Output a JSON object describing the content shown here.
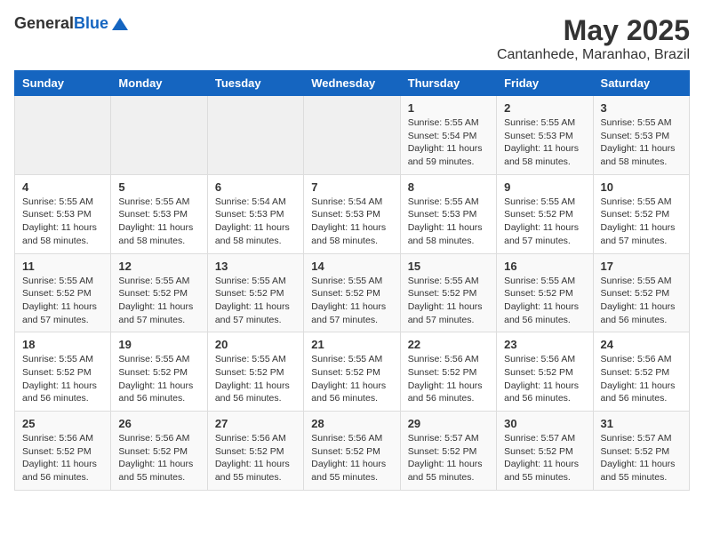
{
  "logo": {
    "general": "General",
    "blue": "Blue"
  },
  "title": "May 2025",
  "subtitle": "Cantanhede, Maranhao, Brazil",
  "days_header": [
    "Sunday",
    "Monday",
    "Tuesday",
    "Wednesday",
    "Thursday",
    "Friday",
    "Saturday"
  ],
  "weeks": [
    [
      {
        "day": "",
        "info": ""
      },
      {
        "day": "",
        "info": ""
      },
      {
        "day": "",
        "info": ""
      },
      {
        "day": "",
        "info": ""
      },
      {
        "day": "1",
        "info": "Sunrise: 5:55 AM\nSunset: 5:54 PM\nDaylight: 11 hours and 59 minutes."
      },
      {
        "day": "2",
        "info": "Sunrise: 5:55 AM\nSunset: 5:53 PM\nDaylight: 11 hours and 58 minutes."
      },
      {
        "day": "3",
        "info": "Sunrise: 5:55 AM\nSunset: 5:53 PM\nDaylight: 11 hours and 58 minutes."
      }
    ],
    [
      {
        "day": "4",
        "info": "Sunrise: 5:55 AM\nSunset: 5:53 PM\nDaylight: 11 hours and 58 minutes."
      },
      {
        "day": "5",
        "info": "Sunrise: 5:55 AM\nSunset: 5:53 PM\nDaylight: 11 hours and 58 minutes."
      },
      {
        "day": "6",
        "info": "Sunrise: 5:54 AM\nSunset: 5:53 PM\nDaylight: 11 hours and 58 minutes."
      },
      {
        "day": "7",
        "info": "Sunrise: 5:54 AM\nSunset: 5:53 PM\nDaylight: 11 hours and 58 minutes."
      },
      {
        "day": "8",
        "info": "Sunrise: 5:55 AM\nSunset: 5:53 PM\nDaylight: 11 hours and 58 minutes."
      },
      {
        "day": "9",
        "info": "Sunrise: 5:55 AM\nSunset: 5:52 PM\nDaylight: 11 hours and 57 minutes."
      },
      {
        "day": "10",
        "info": "Sunrise: 5:55 AM\nSunset: 5:52 PM\nDaylight: 11 hours and 57 minutes."
      }
    ],
    [
      {
        "day": "11",
        "info": "Sunrise: 5:55 AM\nSunset: 5:52 PM\nDaylight: 11 hours and 57 minutes."
      },
      {
        "day": "12",
        "info": "Sunrise: 5:55 AM\nSunset: 5:52 PM\nDaylight: 11 hours and 57 minutes."
      },
      {
        "day": "13",
        "info": "Sunrise: 5:55 AM\nSunset: 5:52 PM\nDaylight: 11 hours and 57 minutes."
      },
      {
        "day": "14",
        "info": "Sunrise: 5:55 AM\nSunset: 5:52 PM\nDaylight: 11 hours and 57 minutes."
      },
      {
        "day": "15",
        "info": "Sunrise: 5:55 AM\nSunset: 5:52 PM\nDaylight: 11 hours and 57 minutes."
      },
      {
        "day": "16",
        "info": "Sunrise: 5:55 AM\nSunset: 5:52 PM\nDaylight: 11 hours and 56 minutes."
      },
      {
        "day": "17",
        "info": "Sunrise: 5:55 AM\nSunset: 5:52 PM\nDaylight: 11 hours and 56 minutes."
      }
    ],
    [
      {
        "day": "18",
        "info": "Sunrise: 5:55 AM\nSunset: 5:52 PM\nDaylight: 11 hours and 56 minutes."
      },
      {
        "day": "19",
        "info": "Sunrise: 5:55 AM\nSunset: 5:52 PM\nDaylight: 11 hours and 56 minutes."
      },
      {
        "day": "20",
        "info": "Sunrise: 5:55 AM\nSunset: 5:52 PM\nDaylight: 11 hours and 56 minutes."
      },
      {
        "day": "21",
        "info": "Sunrise: 5:55 AM\nSunset: 5:52 PM\nDaylight: 11 hours and 56 minutes."
      },
      {
        "day": "22",
        "info": "Sunrise: 5:56 AM\nSunset: 5:52 PM\nDaylight: 11 hours and 56 minutes."
      },
      {
        "day": "23",
        "info": "Sunrise: 5:56 AM\nSunset: 5:52 PM\nDaylight: 11 hours and 56 minutes."
      },
      {
        "day": "24",
        "info": "Sunrise: 5:56 AM\nSunset: 5:52 PM\nDaylight: 11 hours and 56 minutes."
      }
    ],
    [
      {
        "day": "25",
        "info": "Sunrise: 5:56 AM\nSunset: 5:52 PM\nDaylight: 11 hours and 56 minutes."
      },
      {
        "day": "26",
        "info": "Sunrise: 5:56 AM\nSunset: 5:52 PM\nDaylight: 11 hours and 55 minutes."
      },
      {
        "day": "27",
        "info": "Sunrise: 5:56 AM\nSunset: 5:52 PM\nDaylight: 11 hours and 55 minutes."
      },
      {
        "day": "28",
        "info": "Sunrise: 5:56 AM\nSunset: 5:52 PM\nDaylight: 11 hours and 55 minutes."
      },
      {
        "day": "29",
        "info": "Sunrise: 5:57 AM\nSunset: 5:52 PM\nDaylight: 11 hours and 55 minutes."
      },
      {
        "day": "30",
        "info": "Sunrise: 5:57 AM\nSunset: 5:52 PM\nDaylight: 11 hours and 55 minutes."
      },
      {
        "day": "31",
        "info": "Sunrise: 5:57 AM\nSunset: 5:52 PM\nDaylight: 11 hours and 55 minutes."
      }
    ]
  ]
}
